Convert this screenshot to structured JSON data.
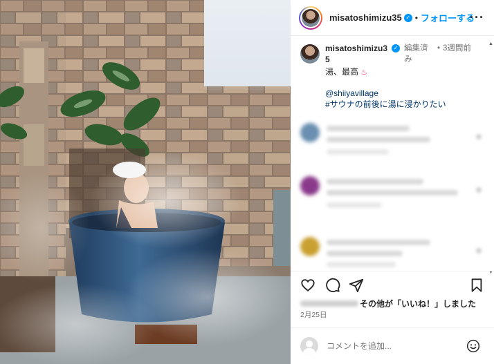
{
  "header": {
    "username": "misatoshimizu35",
    "separator": "•",
    "follow_label": "フォローする",
    "more_label": "···"
  },
  "caption": {
    "username": "misatoshimizu35",
    "edited_label": "編集済み",
    "separator": "•",
    "time_label": "3週間前",
    "text": "湯、最高",
    "onsen_emoji": "♨",
    "mention": "@shiiyavillage",
    "hashtag": "#サウナの前後に湯に浸かりたい"
  },
  "comments": [
    {
      "avatar_color": "#6a8fb0"
    },
    {
      "avatar_color": "#8a3a8a"
    },
    {
      "avatar_color": "#c9a030"
    }
  ],
  "likes": {
    "others_label": "その他",
    "suffix_label": "が「いいね！」しました"
  },
  "date": "2月25日",
  "comment_input": {
    "placeholder": "コメントを追加..."
  },
  "icons": {
    "like": "heart-icon",
    "comment": "comment-icon",
    "share": "send-icon",
    "save": "bookmark-icon",
    "emoji": "emoji-icon"
  },
  "colors": {
    "accent": "#0095f6",
    "link": "#00376b"
  }
}
